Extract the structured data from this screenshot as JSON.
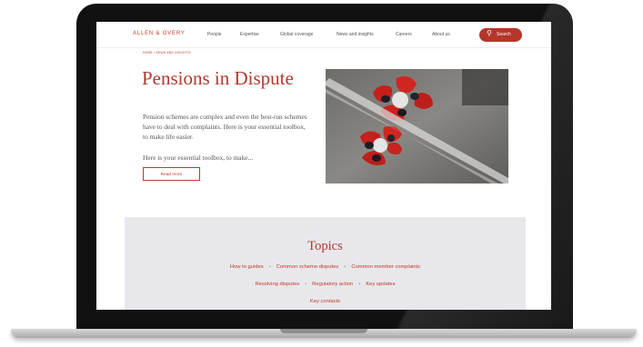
{
  "header": {
    "logo": "ALLEN & OVERY",
    "nav": [
      "People",
      "Expertise",
      "Global coverage",
      "News and insights",
      "Careers",
      "About us"
    ],
    "search_label": "Search",
    "search_icon": "search-icon"
  },
  "breadcrumb": "HOME / NEWS AND INSIGHTS",
  "article": {
    "title": "Pensions in Dispute",
    "intro": "Pension schemes are complex and even the best-run schemes have to deal with complaints. Here is your essential toolbox, to make life easier.",
    "teaser": "Here is your essential toolbox, to make...",
    "read_more": "Read more"
  },
  "topics": {
    "heading": "Topics",
    "row1": [
      "How to guides",
      "Common scheme disputes",
      "Common member complaints"
    ],
    "row2": [
      "Resolving disputes",
      "Regulatory action",
      "Key updates"
    ],
    "row3": [
      "Key contacts"
    ],
    "separator": "•"
  },
  "colors": {
    "brand_red": "#b6352b",
    "topics_bg": "#e8e8ec"
  }
}
